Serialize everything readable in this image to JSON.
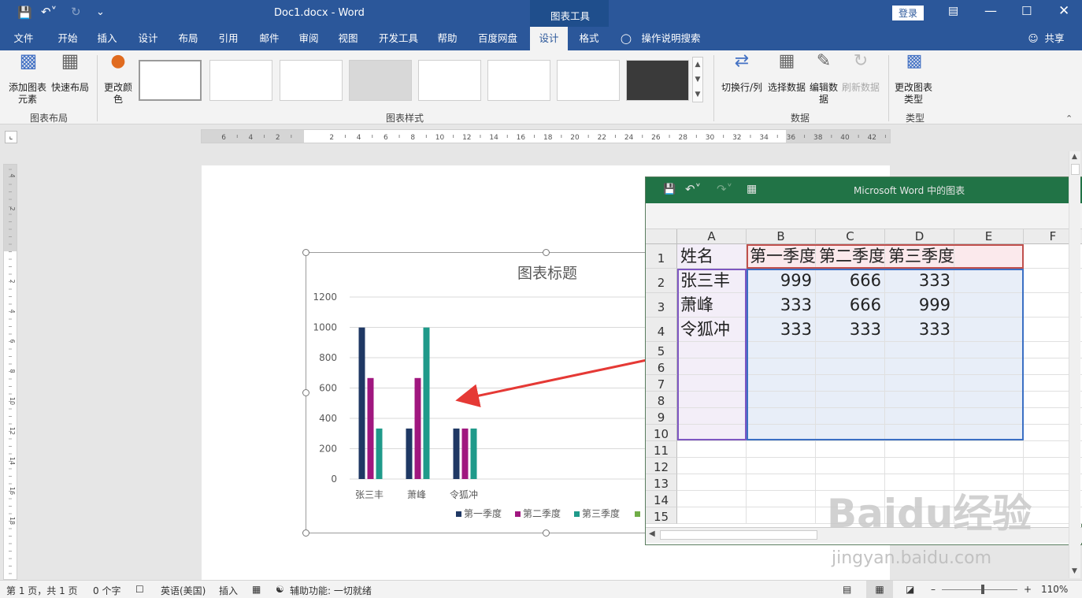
{
  "titlebar": {
    "doc_title": "Doc1.docx  -  Word",
    "context_tools": "图表工具",
    "signin": "登录"
  },
  "tabs": [
    "文件",
    "开始",
    "插入",
    "设计",
    "布局",
    "引用",
    "邮件",
    "审阅",
    "视图",
    "开发工具",
    "帮助",
    "百度网盘",
    "设计",
    "格式"
  ],
  "search_hint": "操作说明搜索",
  "share": "共享",
  "ribbon": {
    "add_element": "添加图表元素",
    "quick_layout": "快速布局",
    "change_color": "更改颜色",
    "group_layout": "图表布局",
    "group_styles": "图表样式",
    "switch_rowcol": "切换行/列",
    "select_data": "选择数据",
    "edit_data": "编辑数据",
    "refresh_data": "刷新数据",
    "group_data": "数据",
    "change_type": "更改图表类型",
    "group_type": "类型"
  },
  "ruler_labels": [
    "6",
    "4",
    "2",
    "2",
    "4",
    "6",
    "8",
    "10",
    "12",
    "14",
    "16",
    "18",
    "20",
    "22",
    "24",
    "26",
    "28",
    "30",
    "32",
    "34",
    "36",
    "38",
    "40",
    "42"
  ],
  "vruler_labels": [
    "4",
    "2",
    "2",
    "4",
    "6",
    "8",
    "10",
    "12",
    "14",
    "16",
    "18"
  ],
  "chart_data": {
    "type": "bar",
    "title": "图表标题",
    "categories": [
      "张三丰",
      "萧峰",
      "令狐冲"
    ],
    "series": [
      {
        "name": "第一季度",
        "values": [
          999,
          333,
          333
        ],
        "color": "#1f3864"
      },
      {
        "name": "第二季度",
        "values": [
          666,
          666,
          333
        ],
        "color": "#a0177f"
      },
      {
        "name": "第三季度",
        "values": [
          333,
          999,
          333
        ],
        "color": "#1f9a8a"
      }
    ],
    "extra_legend_color": "#70ad47",
    "yticks": [
      "1200",
      "1000",
      "800",
      "600",
      "400",
      "200",
      "0"
    ],
    "ylim": [
      0,
      1200
    ],
    "grid": true,
    "legend": "bottom"
  },
  "excel": {
    "title": "Microsoft Word 中的图表",
    "columns": [
      "A",
      "B",
      "C",
      "D",
      "E",
      "F"
    ],
    "rows": [
      "1",
      "2",
      "3",
      "4",
      "5",
      "6",
      "7",
      "8",
      "9",
      "10",
      "11",
      "12",
      "13",
      "14",
      "15"
    ],
    "cells": [
      [
        "姓名",
        "第一季度",
        "第二季度",
        "第三季度"
      ],
      [
        "张三丰",
        "999",
        "666",
        "333"
      ],
      [
        "萧峰",
        "333",
        "666",
        "999"
      ],
      [
        "令狐冲",
        "333",
        "333",
        "333"
      ]
    ]
  },
  "status": {
    "page": "第 1 页，共 1 页",
    "words": "0 个字",
    "lang": "英语(美国)",
    "mode": "插入",
    "access": "辅助功能: 一切就绪",
    "zoom": "110%"
  },
  "watermark": {
    "main": "Baidu经验",
    "sub": "jingyan.baidu.com"
  }
}
